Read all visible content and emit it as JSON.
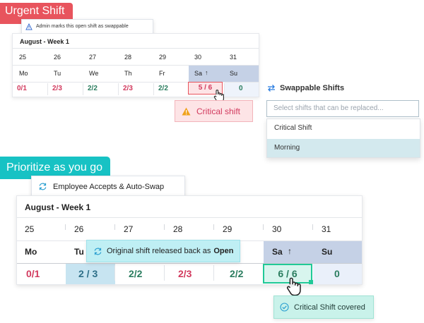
{
  "urgent_tag": "Urgent Shift",
  "admin_tip": "Admin marks this open shift as swappable",
  "small_calendar": {
    "title": "August - Week 1",
    "dates": [
      "25",
      "26",
      "27",
      "28",
      "29",
      "30",
      "31"
    ],
    "days": [
      "Mo",
      "Tu",
      "We",
      "Th",
      "Fr",
      "Sa",
      "Su"
    ],
    "counts": [
      "0/1",
      "2/3",
      "2/2",
      "2/3",
      "2/2",
      "5 / 6",
      "0"
    ]
  },
  "critical_badge": "Critical shift",
  "swappable": {
    "label": "Swappable Shifts",
    "placeholder": "Select shifts that can be replaced...",
    "options": [
      "Critical Shift",
      "Morning"
    ]
  },
  "prioritize_tag": "Prioritize as you go",
  "auto_swap_tip": "Employee Accepts & Auto-Swap",
  "large_calendar": {
    "title": "August - Week 1",
    "dates": [
      "25",
      "26",
      "27",
      "28",
      "29",
      "30",
      "31"
    ],
    "days": [
      "Mo",
      "Tu",
      "Sa",
      "Su"
    ],
    "counts": [
      "0/1",
      "2 / 3",
      "2/2",
      "2/3",
      "2/2",
      "6 / 6",
      "0"
    ]
  },
  "released_tip": {
    "prefix": "Original shift released back as",
    "emphasis": "Open"
  },
  "covered_badge": "Critical Shift covered",
  "colors": {
    "red_tag": "#e8545d",
    "teal_tag": "#17c2c4",
    "understaffed": "#d23a5e",
    "staffed": "#2b7d5f",
    "weekend_header": "#c5d1e6",
    "tip_teal": "#bfeff4",
    "success_badge": "#c9f2ea"
  },
  "icons": [
    "refresh-icon",
    "warning-icon",
    "swap-arrows-icon",
    "hand-pointer-icon",
    "check-circle-icon",
    "info-icon",
    "up-arrow-icon"
  ]
}
